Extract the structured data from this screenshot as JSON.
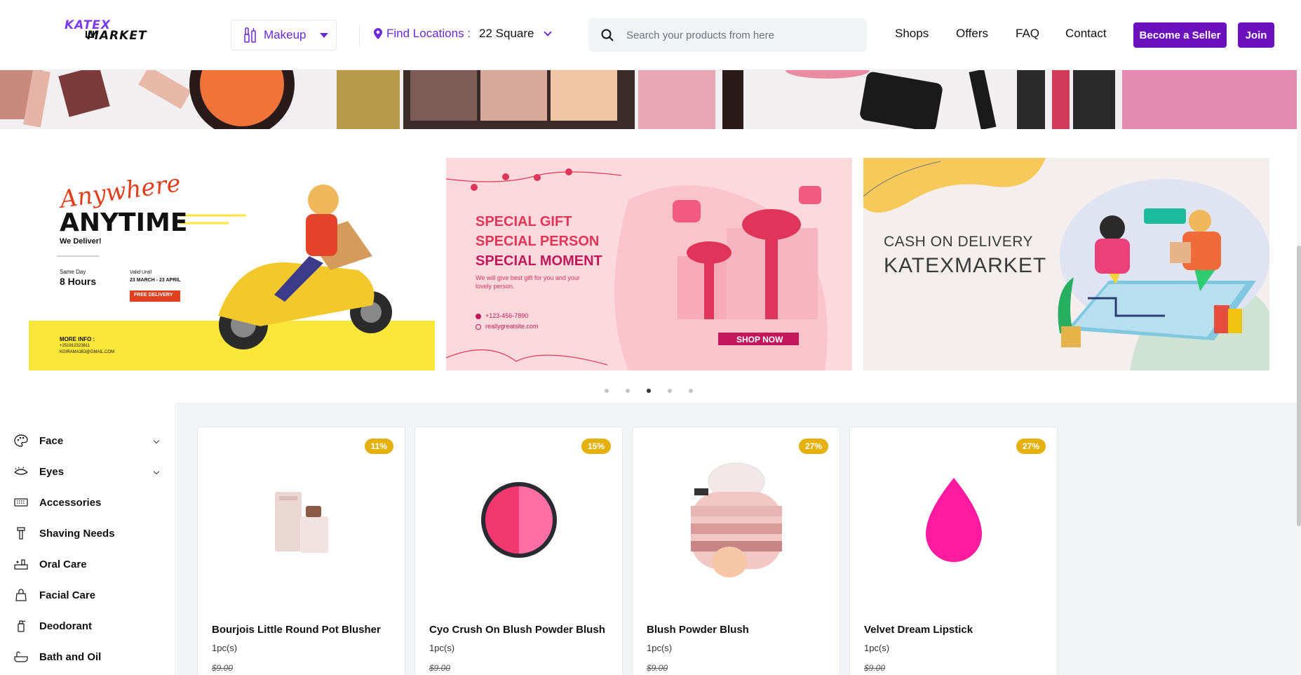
{
  "header": {
    "logo": {
      "line1": "KATEX",
      "line2": "MARKET"
    },
    "category_button": "Makeup",
    "location": {
      "label": "Find Locations :",
      "value": "22 Square"
    },
    "search_placeholder": "Search your products from here",
    "nav": [
      "Shops",
      "Offers",
      "FAQ",
      "Contact"
    ],
    "become_seller": "Become a Seller",
    "join": "Join"
  },
  "banners": {
    "delivery": {
      "script": "Anywhere",
      "headline": "ANYTIME",
      "tagline": "We Deliver!",
      "same_day_label": "Same Day",
      "same_day_value": "8 Hours",
      "valid_label": "Valid Until",
      "valid_value": "23 MARCH - 23 APRIL",
      "badge": "FREE DELIVERY",
      "more_info": "MORE INFO :",
      "phone": "+251912323811",
      "email": "KGIRAMA363@GMAIL.COM"
    },
    "gift": {
      "line1": "SPECIAL GIFT",
      "line2": "SPECIAL PERSON",
      "line3": "SPECIAL MOMENT",
      "sub": "We will give best gift for you and your lovely person.",
      "phone": "+123-456-7890",
      "site": "reallygreatsite.com",
      "cta": "SHOP NOW"
    },
    "cod": {
      "line1": "CASH ON DELIVERY",
      "line2": "KATEXMARKET"
    },
    "active_dot_index": 2
  },
  "sidebar": {
    "items": [
      {
        "label": "Face",
        "icon": "palette-icon",
        "expandable": true
      },
      {
        "label": "Eyes",
        "icon": "eye-icon",
        "expandable": true
      },
      {
        "label": "Accessories",
        "icon": "keyboard-icon",
        "expandable": false
      },
      {
        "label": "Shaving Needs",
        "icon": "razor-icon",
        "expandable": false
      },
      {
        "label": "Oral Care",
        "icon": "toothpaste-icon",
        "expandable": false
      },
      {
        "label": "Facial Care",
        "icon": "bag-icon",
        "expandable": false
      },
      {
        "label": "Deodorant",
        "icon": "spray-icon",
        "expandable": false
      },
      {
        "label": "Bath and Oil",
        "icon": "bathtub-icon",
        "expandable": false
      }
    ]
  },
  "products": [
    {
      "name": "Bourjois Little Round Pot Blusher",
      "unit": "1pc(s)",
      "discount": "11%",
      "price": "$9.00"
    },
    {
      "name": "Cyo Crush On Blush Powder Blush",
      "unit": "1pc(s)",
      "discount": "15%",
      "price": "$9.00"
    },
    {
      "name": "Blush Powder Blush",
      "unit": "1pc(s)",
      "discount": "27%",
      "price": "$9.00"
    },
    {
      "name": "Velvet Dream Lipstick",
      "unit": "1pc(s)",
      "discount": "27%",
      "price": "$9.00"
    }
  ],
  "colors": {
    "brand": "#6b0fbf",
    "badge": "#e5b10d",
    "panel_bg": "#f3f4f6"
  }
}
